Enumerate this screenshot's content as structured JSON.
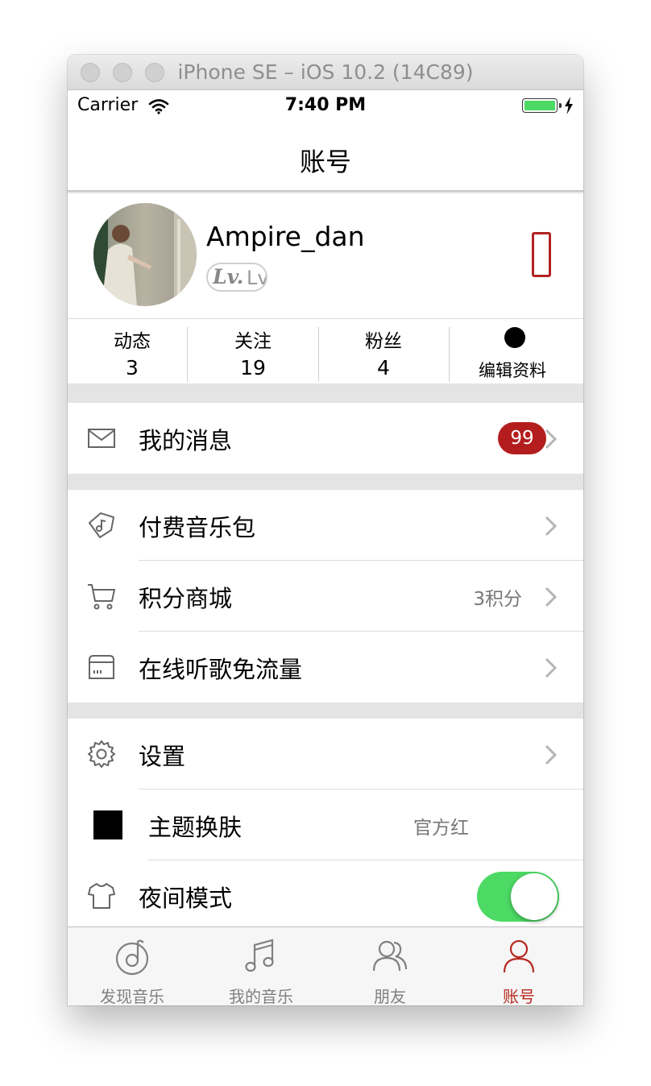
{
  "window": {
    "title": "iPhone SE – iOS 10.2 (14C89)"
  },
  "status_bar": {
    "carrier": "Carrier",
    "time": "7:40 PM"
  },
  "nav": {
    "title": "账号"
  },
  "profile": {
    "username": "Ampire_dan",
    "level_prefix": "Lv.",
    "level_text": "Lv"
  },
  "stats": [
    {
      "label": "动态",
      "value": "3"
    },
    {
      "label": "关注",
      "value": "19"
    },
    {
      "label": "粉丝",
      "value": "4"
    }
  ],
  "edit_profile": {
    "label": "编辑资料"
  },
  "messages": {
    "label": "我的消息",
    "badge": "99",
    "icon": "mail-icon"
  },
  "menu_group_2": [
    {
      "label": "付费音乐包",
      "detail": "",
      "icon": "music-tag-icon"
    },
    {
      "label": "积分商城",
      "detail": "3积分",
      "icon": "cart-icon"
    },
    {
      "label": "在线听歌免流量",
      "detail": "",
      "icon": "sim-card-icon"
    }
  ],
  "settings": {
    "label": "设置",
    "icon": "gear-icon"
  },
  "theme": {
    "label": "主题换肤",
    "detail": "官方红"
  },
  "night_mode": {
    "label": "夜间模式",
    "enabled": true,
    "icon": "tshirt-icon"
  },
  "tabs": [
    {
      "label": "发现音乐",
      "icon": "discover-icon",
      "active": false
    },
    {
      "label": "我的音乐",
      "icon": "music-note-icon",
      "active": false
    },
    {
      "label": "朋友",
      "icon": "friends-icon",
      "active": false
    },
    {
      "label": "账号",
      "icon": "account-icon",
      "active": true
    }
  ],
  "colors": {
    "accent": "#b72a1f",
    "badge": "#b41d1d",
    "switch_on": "#4cd964",
    "battery": "#4cd964",
    "background": "#e4e4e4"
  }
}
